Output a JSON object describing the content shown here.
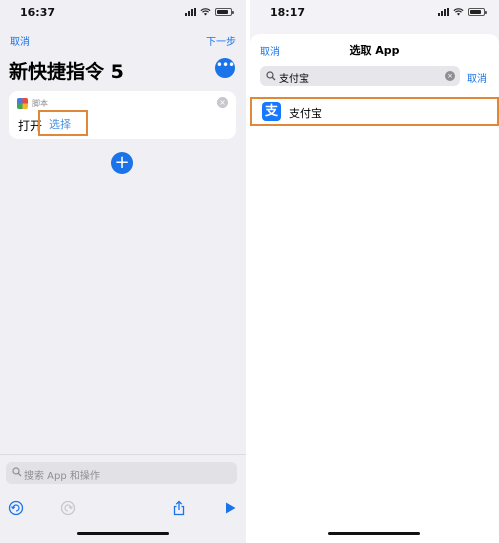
{
  "left": {
    "status": {
      "time": "16:37"
    },
    "nav": {
      "cancel": "取消",
      "next": "下一步"
    },
    "title": "新快捷指令 5",
    "more_glyph": "•••",
    "action_card": {
      "category": "脚本",
      "verb": "打开",
      "placeholder": "选择",
      "close_glyph": "×",
      "icon": "scripting-grid-icon"
    },
    "add_glyph": "+",
    "search": {
      "placeholder": "搜索 App 和操作"
    },
    "toolbar": [
      "undo-icon",
      "redo-icon",
      "share-icon",
      "play-icon"
    ]
  },
  "right": {
    "status": {
      "time": "18:17"
    },
    "header": {
      "cancel": "取消",
      "title": "选取 App"
    },
    "search": {
      "value": "支付宝",
      "cancel": "取消",
      "clear_glyph": "×"
    },
    "results": [
      {
        "name": "支付宝",
        "icon_glyph": "支",
        "icon_color": "#1677ff"
      }
    ]
  },
  "colors": {
    "accent": "#1a73e8",
    "highlight": "#e0883a"
  }
}
